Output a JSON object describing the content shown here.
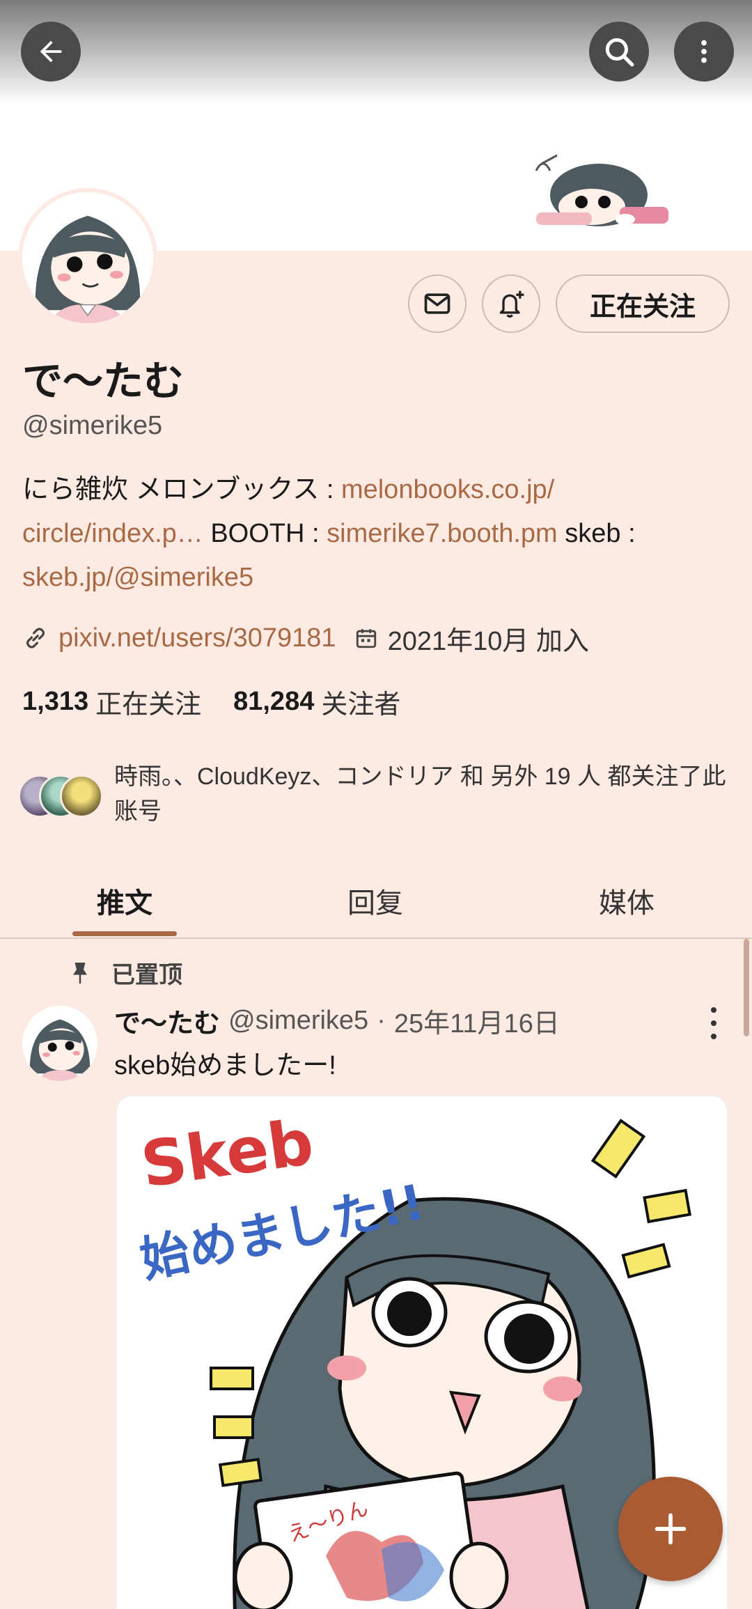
{
  "profile": {
    "display_name": "で〜たむ",
    "handle": "@simerike5",
    "bio": {
      "text1": "にら雑炊  メロンブックス : ",
      "link1": "melonbooks.co.jp/ circle/index.p…",
      "text2": " BOOTH : ",
      "link2": "simerike7.booth.pm",
      "text3": " skeb : ",
      "link3": "skeb.jp/@simerike5"
    },
    "website": "pixiv.net/users/3079181",
    "joined": "2021年10月 加入",
    "following_count": "1,313",
    "following_label": "正在关注",
    "followers_count": "81,284",
    "followers_label": "关注者",
    "followed_by": "時雨。、CloudKeyz、コンドリア 和 另外 19 人 都关注了此账号"
  },
  "actions": {
    "follow_button": "正在关注",
    "message_icon": "mail-icon",
    "notify_icon": "bell-plus-icon"
  },
  "topbar": {
    "back_icon": "back-arrow-icon",
    "search_icon": "search-icon",
    "more_icon": "more-vertical-icon"
  },
  "tabs": [
    {
      "label": "推文"
    },
    {
      "label": "回复"
    },
    {
      "label": "媒体"
    }
  ],
  "post": {
    "pinned_label": "已置顶",
    "author_name": "で〜たむ",
    "author_handle": "@simerike5",
    "separator": "·",
    "date": "25年11月16日",
    "text": "skeb始めましたー!",
    "image_text_1": "Skeb",
    "image_text_2": "始めました!!",
    "image_text_3": "え〜りん"
  },
  "colors": {
    "background": "#fdeae3",
    "accent": "#a86a45",
    "fab": "#a95c33"
  }
}
